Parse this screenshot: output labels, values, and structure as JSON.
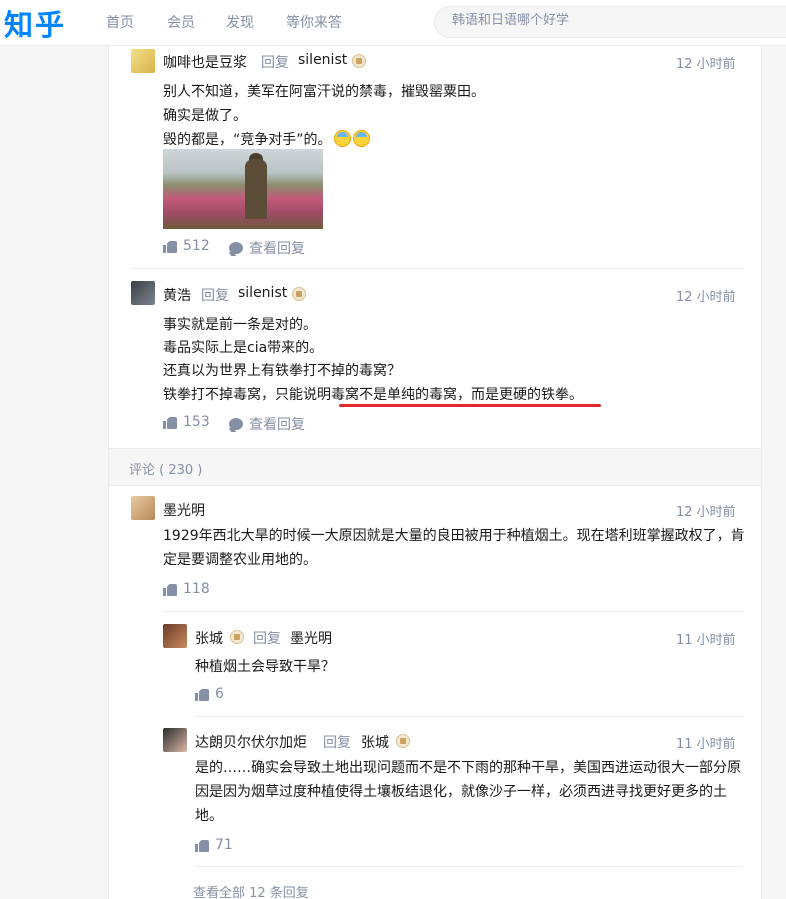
{
  "nav": {
    "logo": "知乎",
    "links": [
      "首页",
      "会员",
      "发现",
      "等你来答"
    ],
    "search_placeholder": "韩语和日语哪个好学"
  },
  "replies_top": [
    {
      "author": "咖啡也是豆浆",
      "reply_word": "回复",
      "reply_to": "silenist",
      "time": "12 小时前",
      "lines": [
        "别人不知道，美军在阿富汗说的禁毒，摧毁罂粟田。",
        "确实是做了。",
        "毁的都是，“竞争对手”的。"
      ],
      "likes": "512",
      "view_replies": "查看回复"
    },
    {
      "author": "黄浩",
      "reply_word": "回复",
      "reply_to": "silenist",
      "time": "12 小时前",
      "lines": [
        "事实就是前一条是对的。",
        "毒品实际上是cia带来的。",
        "还真以为世界上有铁拳打不掉的毒窝？",
        "铁拳打不掉毒窝，只能说明毒窝不是单纯的毒窝，而是更硬的铁拳。"
      ],
      "likes": "153",
      "view_replies": "查看回复"
    }
  ],
  "comments_header": "评论 ( 230 )",
  "comment": {
    "author": "墨光明",
    "time": "12 小时前",
    "text": "1929年西北大旱的时候一大原因就是大量的良田被用于种植烟土。现在塔利班掌握政权了，肯定是要调整农业用地的。",
    "likes": "118"
  },
  "sub_replies": [
    {
      "author": "张城",
      "reply_word": "回复",
      "reply_to": "墨光明",
      "time": "11 小时前",
      "text": "种植烟土会导致干旱？",
      "likes": "6"
    },
    {
      "author": "达朗贝尔伏尔加炬",
      "reply_word": "回复",
      "reply_to": "张城",
      "time": "11 小时前",
      "text": "是的……确实会导致土地出现问题而不是不下雨的那种干旱，美国西进运动很大一部分原因是因为烟草过度种植使得土壤板结退化，就像沙子一样，必须西进寻找更好更多的土地。",
      "likes": "71"
    }
  ],
  "view_all": "查看全部 12 条回复",
  "colors": {
    "brand": "#0084ff",
    "meta": "#8590a6",
    "highlight_underline": "#e0282e"
  }
}
